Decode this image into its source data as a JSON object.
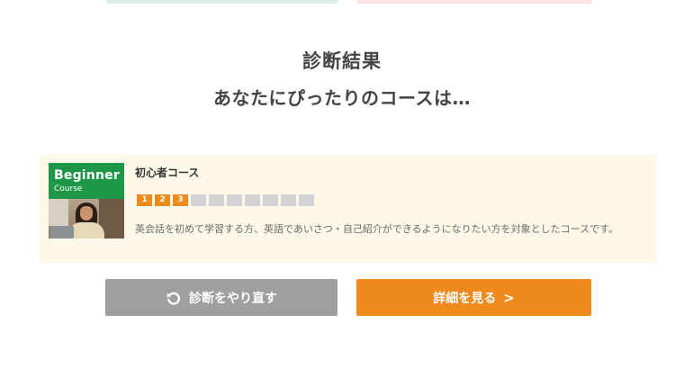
{
  "header": {
    "title": "診断結果",
    "subtitle": "あなたにぴったりのコースは…"
  },
  "result": {
    "thumbnail": {
      "title": "Beginner",
      "subtitle": "Course"
    },
    "course_name": "初心者コース",
    "levels": [
      "1",
      "2",
      "3",
      "",
      "",
      "",
      "",
      "",
      "",
      ""
    ],
    "active_levels": 3,
    "description": "英会話を初めて学習する方、英語であいさつ・自己紹介ができるようになりたい方を対象としたコースです。"
  },
  "actions": {
    "retry_label": "診断をやり直す",
    "detail_label": "詳細を見る",
    "detail_chevron": ">"
  },
  "colors": {
    "accent": "#f08a1c",
    "card_bg": "#fdf8e7",
    "thumbnail_green": "#1e9848",
    "retry_gray": "#9f9f9f"
  },
  "icons": {
    "retry": "refresh-icon",
    "chevron": "chevron-right-icon"
  }
}
